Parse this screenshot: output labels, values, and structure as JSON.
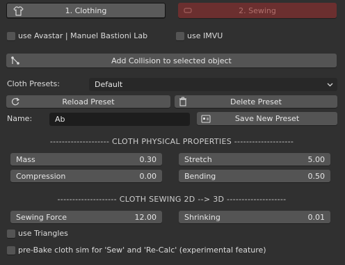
{
  "tabs": {
    "clothing_label": "1. Clothing",
    "sewing_label": "2. Sewing"
  },
  "options": {
    "avastar_label": "use Avastar | Manuel Bastioni Lab",
    "imvu_label": "use IMVU"
  },
  "collision": {
    "button_label": "Add Collision to selected object"
  },
  "presets": {
    "label": "Cloth Presets:",
    "selected": "Default",
    "reload_label": "Reload Preset",
    "delete_label": "Delete Preset",
    "name_label": "Name:",
    "name_value": "Ab",
    "save_label": "Save New Preset"
  },
  "physical": {
    "header": "-------------------- CLOTH PHYSICAL PROPERTIES --------------------",
    "mass_label": "Mass",
    "mass_value": "0.30",
    "stretch_label": "Stretch",
    "stretch_value": "5.00",
    "compression_label": "Compression",
    "compression_value": "0.00",
    "bending_label": "Bending",
    "bending_value": "0.50"
  },
  "sewing": {
    "header": "-------------------- CLOTH SEWING 2D --> 3D --------------------",
    "force_label": "Sewing Force",
    "force_value": "12.00",
    "shrinking_label": "Shrinking",
    "shrinking_value": "0.01",
    "triangles_label": "use Triangles",
    "prebake_label": "pre-Bake cloth sim for 'Sew' and 'Re-Calc' (experimental feature)"
  },
  "icons": {
    "shirt": "shirt-icon",
    "needle": "needle-icon",
    "collision": "collision-icon",
    "reload": "reload-icon",
    "trash": "trash-icon",
    "save": "save-icon",
    "dropdown": "chevron-down-icon"
  },
  "colors": {
    "background": "#303030",
    "button": "#545454",
    "sewing_tab": "#6b2f2f",
    "input_dark": "#1d1d1d"
  }
}
